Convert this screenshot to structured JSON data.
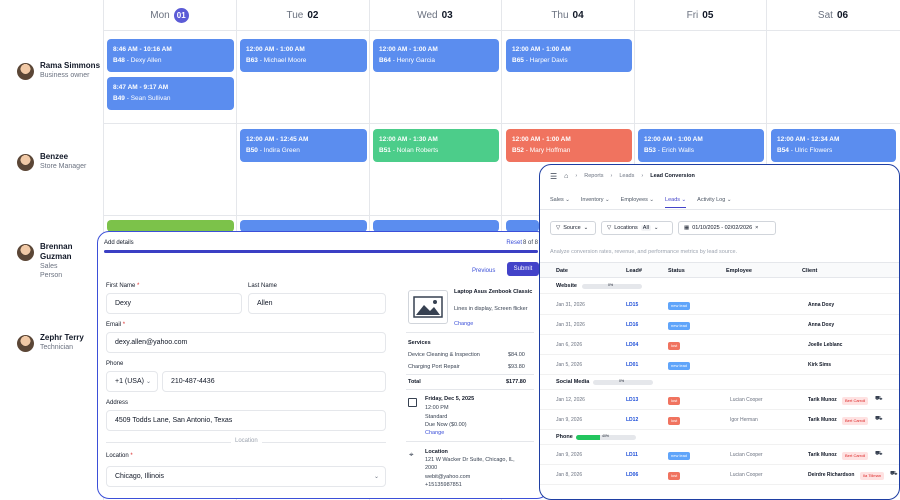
{
  "scheduler": {
    "days": [
      {
        "dow": "Mon",
        "num": "01",
        "today": true
      },
      {
        "dow": "Tue",
        "num": "02"
      },
      {
        "dow": "Wed",
        "num": "03"
      },
      {
        "dow": "Thu",
        "num": "04"
      },
      {
        "dow": "Fri",
        "num": "05"
      },
      {
        "dow": "Sat",
        "num": "06"
      }
    ],
    "people": [
      {
        "name": "Rama Simmons",
        "role": "Business owner"
      },
      {
        "name": "Benzee",
        "role": "Store Manager"
      },
      {
        "name": "Brennan Guzman",
        "role": "Sales Person"
      },
      {
        "name": "Zephr Terry",
        "role": "Technician"
      }
    ],
    "events": [
      {
        "time": "8:46 AM - 10:16 AM",
        "code": "B48",
        "name": "Dexy Allen",
        "color": "#5b8def"
      },
      {
        "time": "8:47 AM - 9:17 AM",
        "code": "B49",
        "name": "Sean Sullivan",
        "color": "#5b8def"
      },
      {
        "time": "12:00 AM - 1:00 AM",
        "code": "B63",
        "name": "Michael Moore",
        "color": "#5b8def"
      },
      {
        "time": "12:00 AM - 1:00 AM",
        "code": "B64",
        "name": "Henry Garcia",
        "color": "#5b8def"
      },
      {
        "time": "12:00 AM - 1:00 AM",
        "code": "B65",
        "name": "Harper Davis",
        "color": "#5b8def"
      },
      {
        "time": "12:00 AM - 12:45 AM",
        "code": "B50",
        "name": "Indira Green",
        "color": "#5b8def"
      },
      {
        "time": "12:00 AM - 1:30 AM",
        "code": "B51",
        "name": "Nolan Roberts",
        "color": "#4ccd8a"
      },
      {
        "time": "12:00 AM - 1:00 AM",
        "code": "B52",
        "name": "Mary Hoffman",
        "color": "#f0735f"
      },
      {
        "time": "12:00 AM - 1:00 AM",
        "code": "B53",
        "name": "Erich Walls",
        "color": "#5b8def"
      },
      {
        "time": "12:00 AM - 12:34 AM",
        "code": "B54",
        "name": "Ulric Flowers",
        "color": "#5b8def"
      }
    ]
  },
  "dialog": {
    "title": "Add details",
    "reset": "Reset",
    "step": "8 of 8",
    "previous": "Previous",
    "submit": "Submit",
    "first_name_label": "First Name",
    "first_name": "Dexy",
    "last_name_label": "Last Name",
    "last_name": "Allen",
    "email_label": "Email",
    "email": "dexy.allen@yahoo.com",
    "phone_label": "Phone",
    "country_code": "+1 (USA)",
    "phone": "210-487-4436",
    "address_label": "Address",
    "address": "4509 Todds Lane, San Antonio, Texas",
    "location_divider": "Location",
    "location_label": "Location",
    "location": "Chicago, Illinois",
    "summary": {
      "device": "Laptop Asus Zenbook Classic",
      "issue": "Lines in display, Screen flicker",
      "change": "Change",
      "services_title": "Services",
      "services": [
        {
          "name": "Device Cleaning & Inspection",
          "price": "$84.00"
        },
        {
          "name": "Charging Port Repair",
          "price": "$93.80"
        }
      ],
      "total_label": "Total",
      "total": "$177.80",
      "date": "Friday, Dec 5, 2025",
      "time": "12:00 PM",
      "type": "Standard",
      "due": "Due Now ($0.00)",
      "loc_title": "Location",
      "loc_address": "121 W Wacker Dr Suite, Chicago, IL, 2000",
      "loc_email": "webit@yahoo.com",
      "loc_phone": "+15135987851"
    }
  },
  "report": {
    "crumbs": [
      "Reports",
      "Leads",
      "Lead Conversion"
    ],
    "nav": [
      "Sales",
      "Inventory",
      "Employees",
      "Leads",
      "Activity Log"
    ],
    "filter_source": "Source",
    "filter_locations": "Locations",
    "filter_all": "All",
    "date_range": "01/10/2025 - 02/02/2026",
    "hint": "Analyze conversion rates, revenue, and performance metrics by lead source.",
    "columns": [
      "Date",
      "Lead#",
      "Status",
      "Employee",
      "Client"
    ],
    "groups": [
      {
        "name": "Website",
        "pct": "0%",
        "fill": 0
      },
      {
        "name": "Social Media",
        "pct": "0%",
        "fill": 0
      },
      {
        "name": "Phone",
        "pct": "40%",
        "fill": 40
      }
    ],
    "rows": [
      {
        "date": "Jan 31, 2026",
        "lead": "LD15",
        "status": "new lead",
        "employee": "",
        "client": "Anna Doxy",
        "tag": ""
      },
      {
        "date": "Jan 31, 2026",
        "lead": "LD16",
        "status": "new lead",
        "employee": "",
        "client": "Anna Doxy",
        "tag": ""
      },
      {
        "date": "Jan 6, 2026",
        "lead": "LD04",
        "status": "lost",
        "employee": "",
        "client": "Joelle Leblanc",
        "tag": ""
      },
      {
        "date": "Jan 5, 2026",
        "lead": "LD01",
        "status": "new lead",
        "employee": "",
        "client": "Kirk Sims",
        "tag": ""
      },
      {
        "date": "Jan 12, 2026",
        "lead": "LD13",
        "status": "lost",
        "employee": "Lucian Cooper",
        "client": "Tarik Munoz",
        "tag": "Bert Carroll"
      },
      {
        "date": "Jan 9, 2026",
        "lead": "LD12",
        "status": "lost",
        "employee": "Igor Herman",
        "client": "Tarik Munoz",
        "tag": "Bert Carroll"
      },
      {
        "date": "Jan 9, 2026",
        "lead": "LD11",
        "status": "new lead",
        "employee": "Lucian Cooper",
        "client": "Tarik Munoz",
        "tag": "Bert Carroll"
      },
      {
        "date": "Jan 8, 2026",
        "lead": "LD06",
        "status": "lost",
        "employee": "Lucian Cooper",
        "client": "Deirdre Richardson",
        "tag": "Ila Tillman"
      }
    ],
    "status_colors": {
      "new lead": "#60a5fa",
      "lost": "#f0735f"
    }
  }
}
